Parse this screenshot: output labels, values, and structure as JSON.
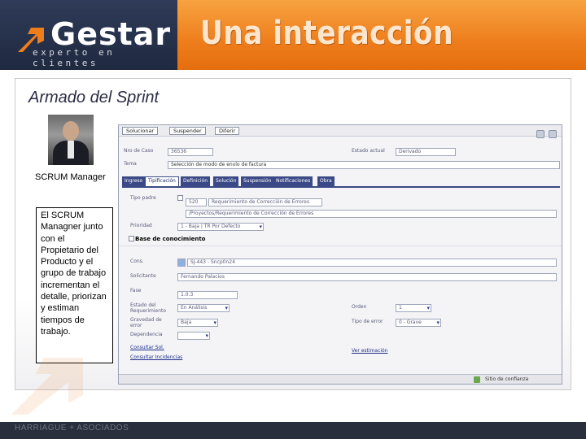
{
  "header": {
    "logo_name": "Gestar",
    "logo_tagline": "experto en clientes",
    "title": "Una interacción"
  },
  "slide": {
    "section_title": "Armado del Sprint",
    "role_label": "SCRUM Manager",
    "description": "El SCRUM Managner junto con el Propietario del Producto y el grupo de trabajo incrementan el detalle, priorizan y estiman tiempos de trabajo."
  },
  "app": {
    "toolbar": {
      "buttons": [
        "Solucionar",
        "Suspender",
        "Diferir"
      ]
    },
    "fields": {
      "nro_caso_label": "Nro de Caso",
      "nro_caso_value": "36536",
      "estado_actual_label": "Estado actual",
      "estado_actual_value": "Derivado",
      "tema_label": "Tema",
      "tema_value": "Selección de modo de envío de factura",
      "tipo_padre_label": "Tipo padre",
      "tipo_padre_code": "520",
      "tipo_padre_desc": "Requerimiento de Corrección de Errores",
      "tipo_padre_path": "/Proyectos/Requerimiento de Corrección de Errores",
      "prioridad_label": "Prioridad",
      "prioridad_value": "1 - Baja | TR Por Defecto",
      "base_conocimiento_label": "Base de conocimiento",
      "cons_label": "Cons.",
      "cons_value": "SJ-443 - Sncp0n24",
      "solicitante_label": "Solicitante",
      "solicitante_value": "Fernando Palacios",
      "fase_label": "Fase",
      "fase_value": "1.0.3",
      "estado_req_label": "Estado del Requerimiento",
      "estado_req_value": "En Análisis",
      "gravedad_label": "Gravedad de error",
      "gravedad_value": "Baja",
      "dependencia_label": "Dependencia",
      "dependencia_value": "",
      "orden_label": "Orden",
      "orden_value": "1",
      "tipo_error_label": "Tipo de error",
      "tipo_error_value": "0 - Grave",
      "link_1": "Consultar Sol.",
      "link_2": "Consultar Incidencias",
      "link_3": "Ver estimación"
    },
    "tabs": [
      "Ingreso",
      "Tipificación",
      "Definición",
      "Solución",
      "Suspensión",
      "Notificaciones",
      "Obra"
    ],
    "active_tab": "Tipificación",
    "status": "Sitio de confianza"
  },
  "footer": {
    "text": "HARRIAGUE + ASOCIADOS"
  },
  "colors": {
    "brand_navy": "#2f3b58",
    "brand_orange": "#ee7d1c",
    "tab_blue": "#3b4a86"
  }
}
